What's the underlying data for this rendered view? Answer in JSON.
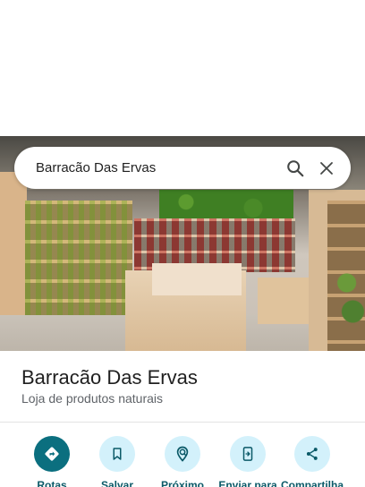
{
  "search": {
    "query": "Barracão Das Ervas"
  },
  "place": {
    "name": "Barracão Das Ervas",
    "category": "Loja de produtos naturais"
  },
  "actions": [
    {
      "label": "Rotas",
      "icon": "directions-icon"
    },
    {
      "label": "Salvar",
      "icon": "bookmark-icon"
    },
    {
      "label": "Próximo",
      "icon": "nearby-icon"
    },
    {
      "label": "Enviar para",
      "icon": "send-to-phone-icon"
    },
    {
      "label": "Compartilha",
      "icon": "share-icon"
    }
  ],
  "colors": {
    "primary_action": "#0b6f7f",
    "secondary_action_bg": "#d3f1fb",
    "action_label": "#0b5a68"
  }
}
